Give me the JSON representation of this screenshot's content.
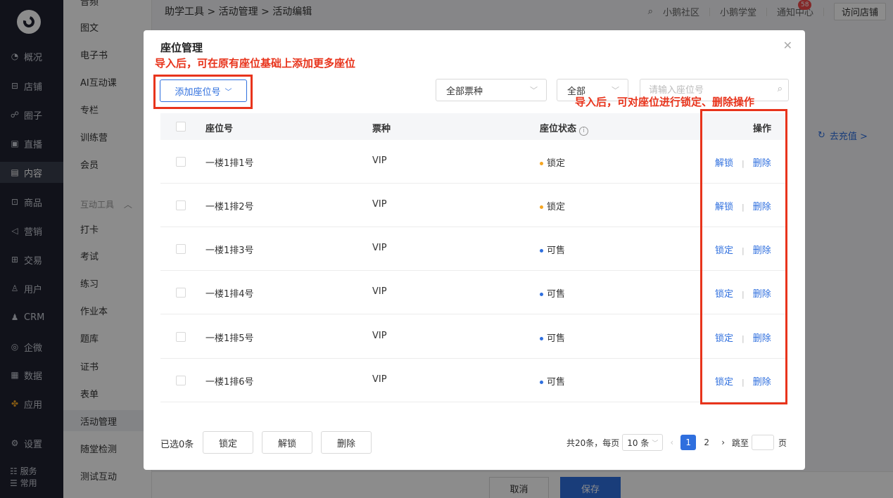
{
  "header": {
    "breadcrumb": "助学工具 > 活动管理 > 活动编辑",
    "links": [
      "小鹅社区",
      "小鹅学堂",
      "通知中心"
    ],
    "notify_badge": "58",
    "visit_store": "访问店铺",
    "recharge": "去充值 >"
  },
  "nav": {
    "items": [
      {
        "label": "概况",
        "icon": "chart-pie-icon"
      },
      {
        "label": "店铺",
        "icon": "store-icon"
      },
      {
        "label": "圈子",
        "icon": "community-icon"
      },
      {
        "label": "直播",
        "icon": "live-icon"
      },
      {
        "label": "内容",
        "icon": "content-icon"
      },
      {
        "label": "商品",
        "icon": "product-icon"
      },
      {
        "label": "营销",
        "icon": "marketing-icon"
      },
      {
        "label": "交易",
        "icon": "trade-icon"
      },
      {
        "label": "用户",
        "icon": "user-icon"
      },
      {
        "label": "CRM",
        "icon": "crm-icon"
      },
      {
        "label": "企微",
        "icon": "wecom-icon"
      },
      {
        "label": "数据",
        "icon": "data-icon"
      },
      {
        "label": "应用",
        "icon": "apps-icon"
      },
      {
        "label": "设置",
        "icon": "settings-icon"
      }
    ],
    "foot": [
      "服务",
      "常用"
    ]
  },
  "subnav": {
    "items_top": [
      "音频",
      "图文",
      "电子书",
      "AI互动课",
      "专栏",
      "训练营",
      "会员"
    ],
    "group_label": "互动工具",
    "items_tools": [
      "打卡",
      "考试",
      "练习",
      "作业本",
      "题库",
      "证书",
      "表单",
      "活动管理",
      "随堂检测",
      "测试互动"
    ]
  },
  "page_footer": {
    "cancel": "取消",
    "save": "保存"
  },
  "modal": {
    "title": "座位管理",
    "add_seat": "添加座位号",
    "ticket_filter": "全部票种",
    "status_filter": "全部",
    "search_placeholder": "请输入座位号",
    "note_top": "导入后，可在原有座位基础上添加更多座位",
    "note_right": "导入后，可对座位进行锁定、删除操作",
    "columns": {
      "seat": "座位号",
      "ticket": "票种",
      "status": "座位状态",
      "ops": "操作"
    },
    "rows": [
      {
        "seat": "一楼1排1号",
        "ticket": "VIP",
        "status": "锁定",
        "status_color": "#f5a623",
        "op1": "解锁",
        "op2": "删除"
      },
      {
        "seat": "一楼1排2号",
        "ticket": "VIP",
        "status": "锁定",
        "status_color": "#f5a623",
        "op1": "解锁",
        "op2": "删除"
      },
      {
        "seat": "一楼1排3号",
        "ticket": "VIP",
        "status": "可售",
        "status_color": "#2f6fde",
        "op1": "锁定",
        "op2": "删除"
      },
      {
        "seat": "一楼1排4号",
        "ticket": "VIP",
        "status": "可售",
        "status_color": "#2f6fde",
        "op1": "锁定",
        "op2": "删除"
      },
      {
        "seat": "一楼1排5号",
        "ticket": "VIP",
        "status": "可售",
        "status_color": "#2f6fde",
        "op1": "锁定",
        "op2": "删除"
      },
      {
        "seat": "一楼1排6号",
        "ticket": "VIP",
        "status": "可售",
        "status_color": "#2f6fde",
        "op1": "锁定",
        "op2": "删除"
      }
    ],
    "footer": {
      "selected": "已选0条",
      "lock": "锁定",
      "unlock": "解锁",
      "delete": "删除",
      "total": "共20条，每页",
      "page_size": "10 条",
      "pages": [
        "1",
        "2"
      ],
      "current_page": "1",
      "jump": "跳至",
      "page_unit": "页"
    }
  },
  "colors": {
    "accent": "#2f6fde",
    "annotation": "#e8341c",
    "locked": "#f5a623"
  }
}
